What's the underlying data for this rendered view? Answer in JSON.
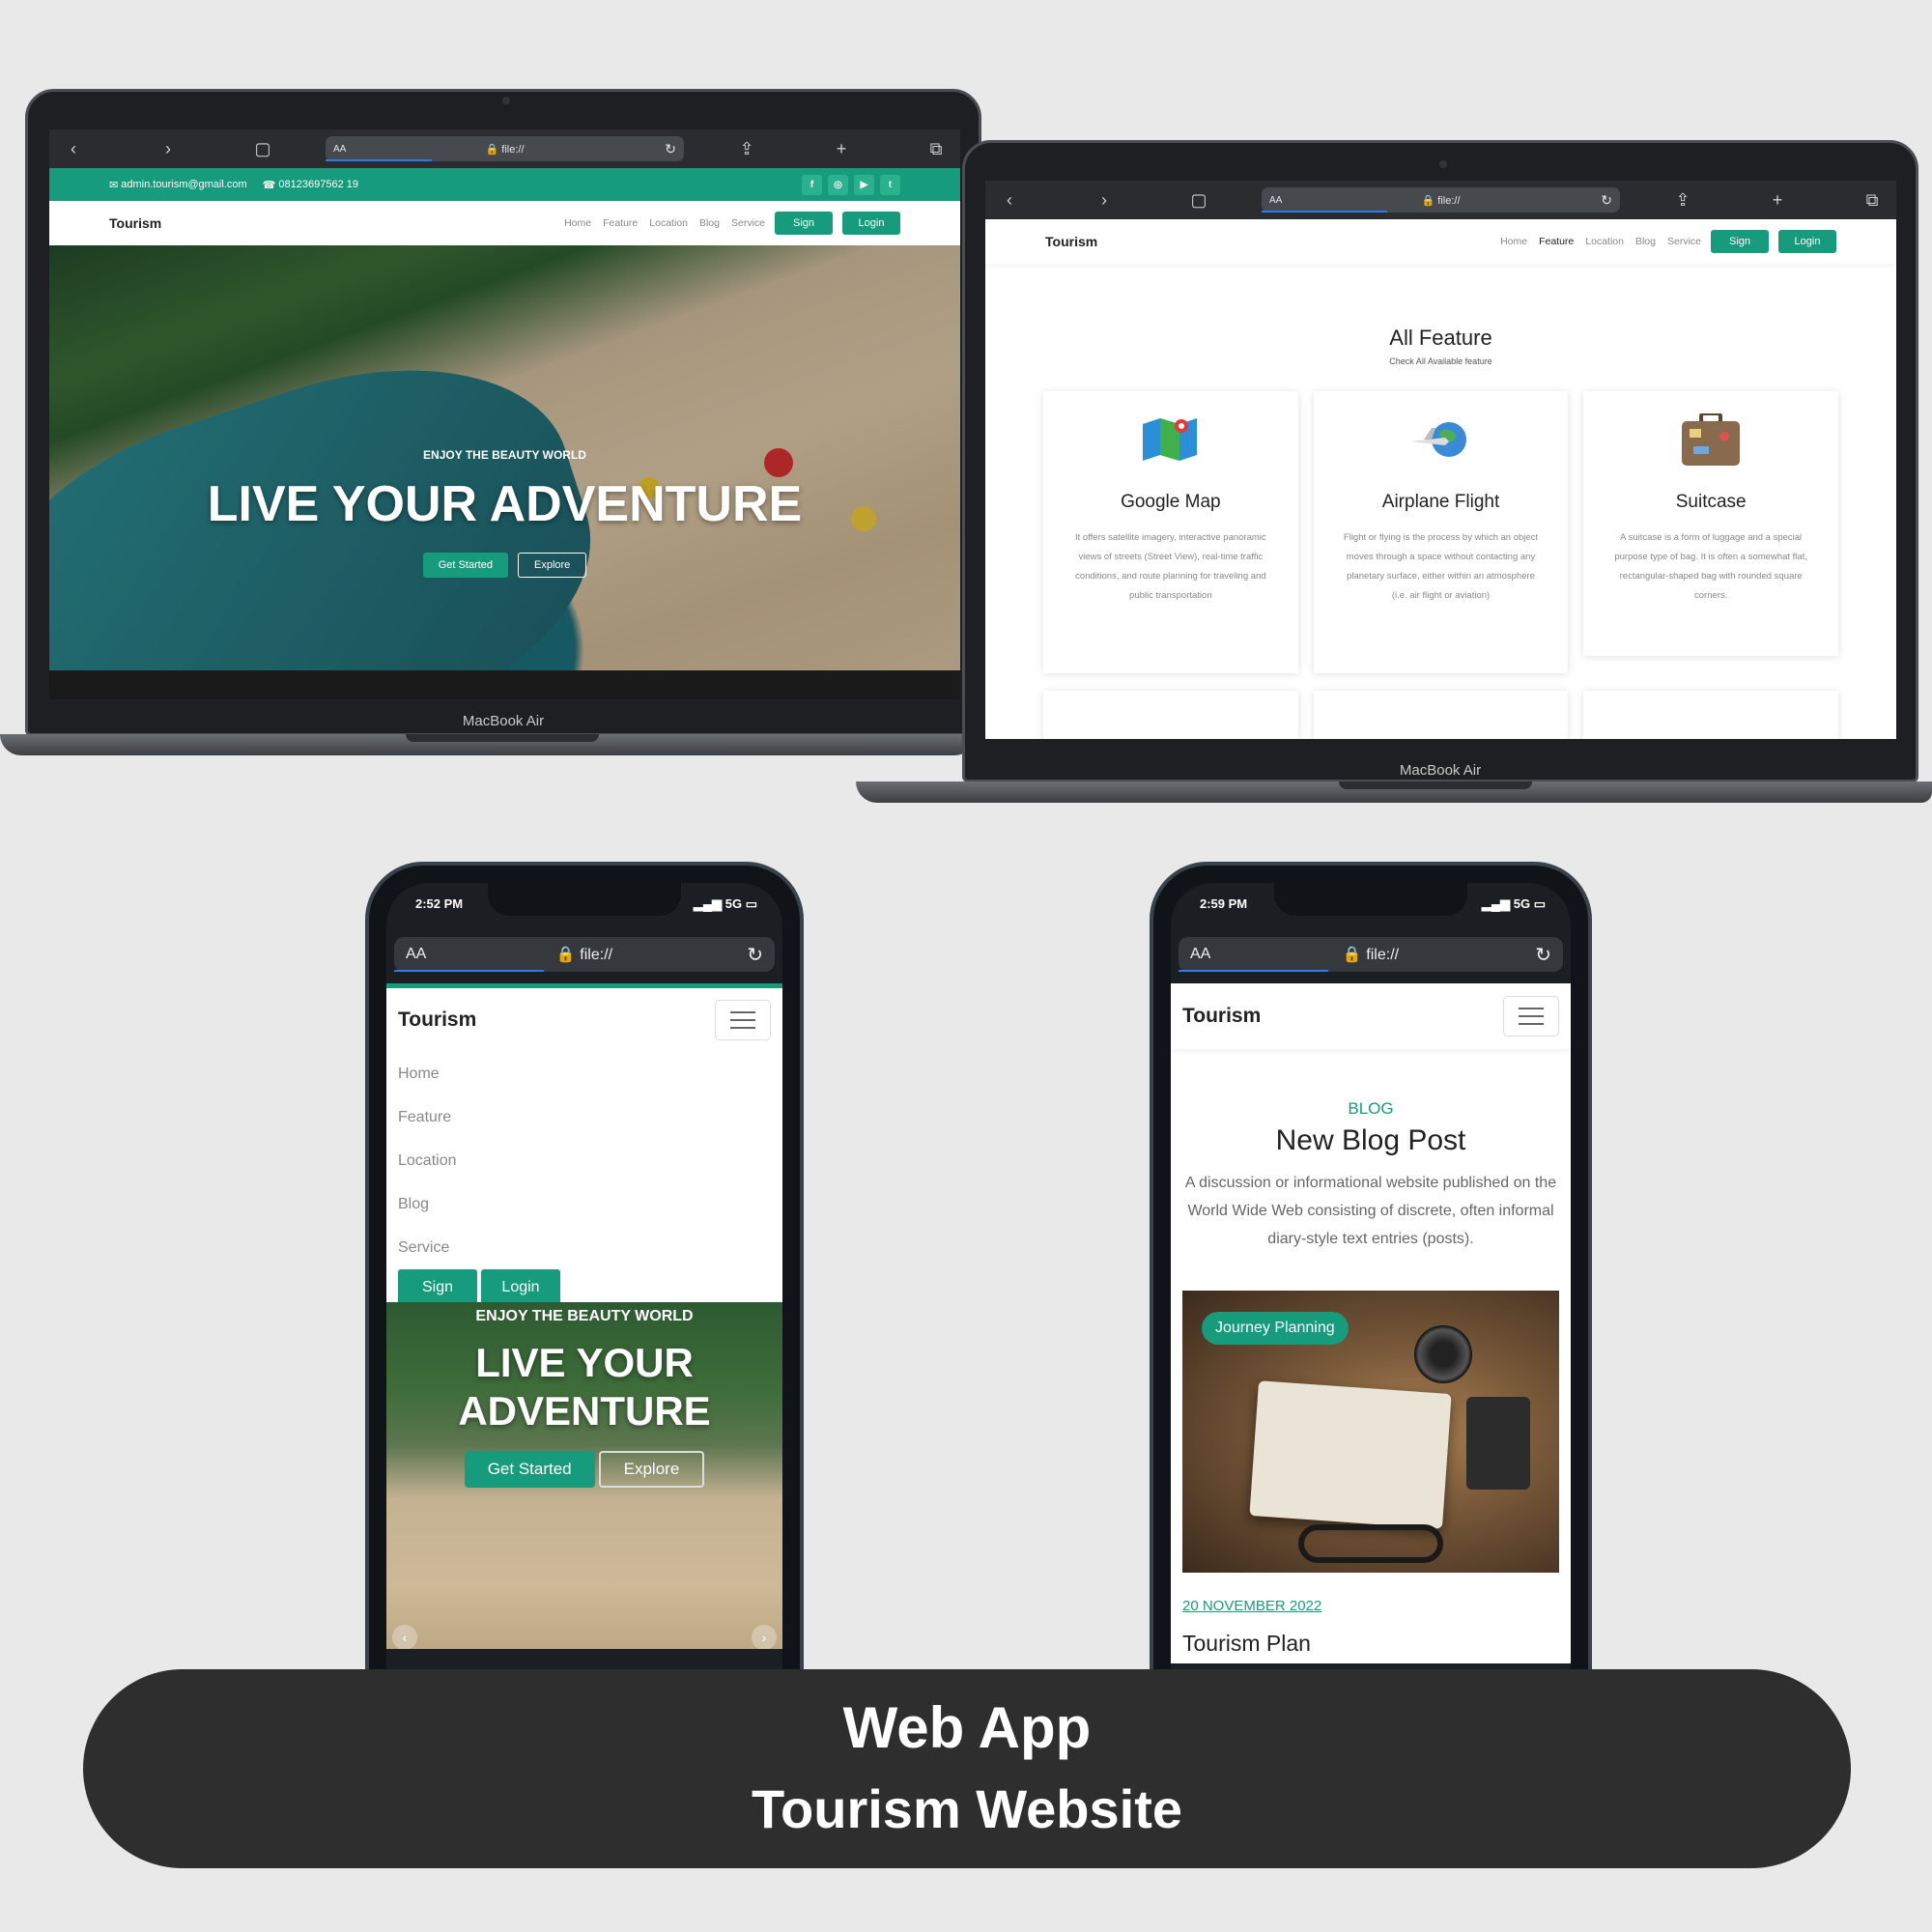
{
  "accent": "#169c7c",
  "browser": {
    "text_size": "AA",
    "url": "file://"
  },
  "device_label": "MacBook Air",
  "contact": {
    "email": "admin.tourism@gmail.com",
    "phone": "08123697562 19"
  },
  "social_icons": [
    "facebook-icon",
    "instagram-icon",
    "youtube-icon",
    "twitter-icon"
  ],
  "nav": {
    "logo": "Tourism",
    "links": [
      "Home",
      "Feature",
      "Location",
      "Blog",
      "Service"
    ],
    "sign": "Sign",
    "login": "Login"
  },
  "hero": {
    "tag": "ENJOY THE BEAUTY WORLD",
    "title": "LIVE YOUR ADVENTURE",
    "title_line1": "LIVE YOUR",
    "title_line2": "ADVENTURE",
    "get_started": "Get Started",
    "explore": "Explore"
  },
  "features": {
    "title": "All Feature",
    "subtitle": "Check All Available feature",
    "cards": [
      {
        "icon": "map-icon",
        "title": "Google Map",
        "desc": "It offers satellite imagery, interactive panoramic views of streets (Street View), real-time traffic conditions, and route planning for traveling and public transportation"
      },
      {
        "icon": "airplane-globe-icon",
        "title": "Airplane Flight",
        "desc": "Flight or flying is the process by which an object moves through a space without contacting any planetary surface, either within an atmosphere (i.e. air flight or aviation)"
      },
      {
        "icon": "suitcase-icon",
        "title": "Suitcase",
        "desc": "A suitcase is a form of luggage and a special purpose type of bag. It is often a somewhat flat, rectangular-shaped bag with rounded square corners."
      }
    ]
  },
  "phone1": {
    "time": "2:52 PM",
    "signal": "5G"
  },
  "phone2": {
    "time": "2:59 PM",
    "signal": "5G"
  },
  "blog": {
    "kicker": "BLOG",
    "title": "New Blog Post",
    "desc": "A discussion or informational website published on the World Wide Web consisting of discrete, often informal diary-style text entries (posts).",
    "category": "Journey Planning",
    "date": "20 NOVEMBER 2022",
    "post_title": "Tourism Plan"
  },
  "banner": {
    "line1": "Web App",
    "line2": "Tourism Website"
  }
}
